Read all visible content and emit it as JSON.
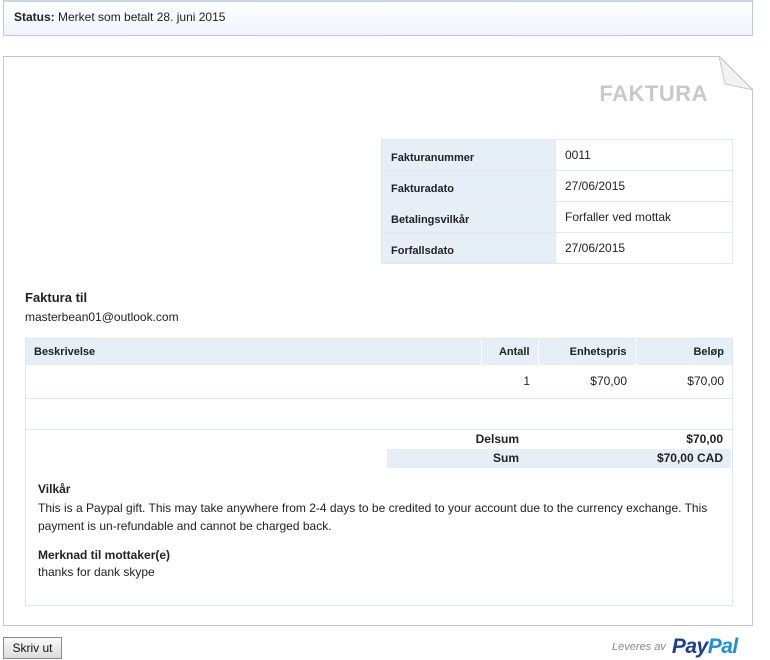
{
  "status": {
    "label": "Status:",
    "text": "Merket som betalt 28. juni 2015"
  },
  "invoice": {
    "title": "FAKTURA",
    "meta": [
      {
        "key": "Fakturanummer",
        "value": "0011"
      },
      {
        "key": "Fakturadato",
        "value": "27/06/2015"
      },
      {
        "key": "Betalingsvilkår",
        "value": "Forfaller ved mottak"
      },
      {
        "key": "Forfallsdato",
        "value": "27/06/2015"
      }
    ],
    "bill_to": {
      "heading": "Faktura til",
      "email": "masterbean01@outlook.com"
    },
    "items": {
      "headers": {
        "description": "Beskrivelse",
        "quantity": "Antall",
        "unit_price": "Enhetspris",
        "amount": "Beløp"
      },
      "rows": [
        {
          "description": "",
          "quantity": "1",
          "unit_price": "$70,00",
          "amount": "$70,00"
        }
      ]
    },
    "totals": {
      "subtotal_label": "Delsum",
      "subtotal_value": "$70,00",
      "total_label": "Sum",
      "total_value": "$70,00 CAD"
    },
    "terms": {
      "heading": "Vilkår",
      "text": "This is a Paypal gift. This may take anywhere from 2-4 days to be credited to your account due to the currency exchange. This payment is un-refundable and cannot be charged back."
    },
    "notes": {
      "heading": "Merknad til mottaker(e)",
      "text": "thanks for dank skype"
    }
  },
  "footer": {
    "print_label": "Skriv ut",
    "powered_by": "Leveres av",
    "brand_part1": "Pay",
    "brand_part2": "Pal"
  },
  "colors": {
    "header_bg": "#e6eef8",
    "paypal_dark": "#1c3f8a",
    "paypal_light": "#1f8fd6"
  }
}
